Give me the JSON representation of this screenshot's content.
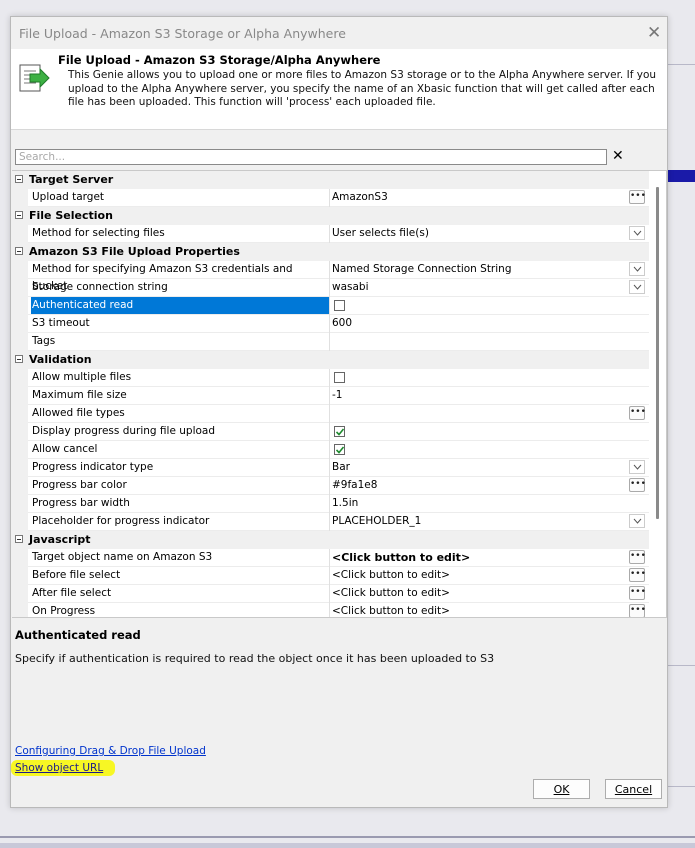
{
  "dialog": {
    "window_title": "File Upload - Amazon S3 Storage or Alpha Anywhere",
    "header_title": "File Upload - Amazon S3 Storage/Alpha Anywhere",
    "header_description": "This Genie allows you to upload one or more files to Amazon S3 storage or to the Alpha Anywhere server. If you upload to the Alpha Anywhere server, you specify the name of an Xbasic function that will get called after each file has been uploaded. This function will 'process' each uploaded file."
  },
  "search": {
    "placeholder": "Search..."
  },
  "grid": {
    "categories": {
      "target_server": "Target Server",
      "file_selection": "File Selection",
      "s3_props": "Amazon S3 File Upload Properties",
      "validation": "Validation",
      "javascript": "Javascript"
    },
    "props": {
      "upload_target": {
        "name": "Upload target",
        "value": "AmazonS3"
      },
      "method_selecting": {
        "name": "Method for selecting files",
        "value": "User selects file(s)"
      },
      "method_credentials": {
        "name": "Method for specifying Amazon S3 credentials and bucket",
        "value": "Named Storage Connection String"
      },
      "storage_connection": {
        "name": "Storage connection string",
        "value": "wasabi"
      },
      "authenticated_read": {
        "name": "Authenticated read",
        "checked": false
      },
      "s3_timeout": {
        "name": "S3 timeout",
        "value": "600"
      },
      "tags": {
        "name": "Tags",
        "value": ""
      },
      "allow_multiple": {
        "name": "Allow multiple files",
        "checked": false
      },
      "max_size": {
        "name": "Maximum file size",
        "value": "-1"
      },
      "allowed_types": {
        "name": "Allowed file types",
        "value": ""
      },
      "display_progress": {
        "name": "Display progress during file upload",
        "checked": true
      },
      "allow_cancel": {
        "name": "Allow cancel",
        "checked": true
      },
      "progress_type": {
        "name": "Progress indicator type",
        "value": "Bar"
      },
      "progress_color": {
        "name": "Progress bar color",
        "value": "#9fa1e8"
      },
      "progress_width": {
        "name": "Progress bar width",
        "value": "1.5in"
      },
      "placeholder": {
        "name": "Placeholder for progress indicator",
        "value": "PLACEHOLDER_1"
      },
      "target_object_name": {
        "name": "Target object name on Amazon S3",
        "value": "<Click button to edit>"
      },
      "before_select": {
        "name": "Before file select",
        "value": "<Click button to edit>"
      },
      "after_select": {
        "name": "After file select",
        "value": "<Click button to edit>"
      },
      "on_progress": {
        "name": "On Progress",
        "value": "<Click button to edit>"
      }
    }
  },
  "description": {
    "title": "Authenticated read",
    "text": "Specify if authentication is required to read the object once it has been uploaded to S3"
  },
  "links": {
    "drag_drop": "Configuring Drag & Drop File Upload",
    "show_url": "Show object URL"
  },
  "buttons": {
    "ok": "OK",
    "cancel": "Cancel"
  },
  "colors": {
    "selection": "#0078d7",
    "highlight": "#f8f800",
    "link": "#0033cc"
  }
}
